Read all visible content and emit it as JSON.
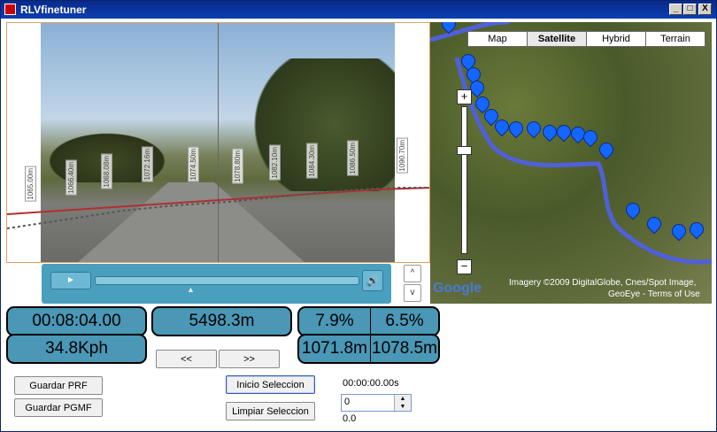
{
  "window": {
    "title": "RLVfinetuner",
    "controls": {
      "minimize": "_",
      "maximize": "□",
      "close": "X"
    }
  },
  "video": {
    "elevation_labels": [
      "1065.00m",
      "1066.40m",
      "1068.08m",
      "1072.16m",
      "1074.50m",
      "1078.80m",
      "1082.10m",
      "1084.30m",
      "1086.50m",
      "1090.70m"
    ],
    "player": {
      "play_icon": "play-icon",
      "volume_icon": "volume-icon"
    }
  },
  "nav_arrows": {
    "up": "^",
    "down": "v"
  },
  "map": {
    "types": [
      "Map",
      "Satellite",
      "Hybrid",
      "Terrain"
    ],
    "active_type": "Satellite",
    "attribution_line1": "Imagery ©2009  DigitalGlobe, Cnes/Spot Image,",
    "attribution_line2": "GeoEye - Terms of Use",
    "logo": "Google",
    "zoom_in": "+",
    "zoom_out": "−"
  },
  "readouts": {
    "time": "00:08:04.00",
    "distance": "5498.3m",
    "slope_a": "7.9%",
    "slope_b": "6.5%",
    "speed": "34.8Kph",
    "altitude_a": "1071.8m",
    "altitude_b": "1078.5m"
  },
  "step_buttons": {
    "back": "<<",
    "forward": ">>"
  },
  "buttons": {
    "guardar_prf": "Guardar PRF",
    "guardar_pgmf": "Guardar PGMF",
    "inicio_seleccion": "Inicio Seleccion",
    "limpiar_seleccion": "Limpiar Seleccion"
  },
  "selection": {
    "timestamp": "00:00:00.00s",
    "spinner_value": "0",
    "value_below": "0.0"
  }
}
